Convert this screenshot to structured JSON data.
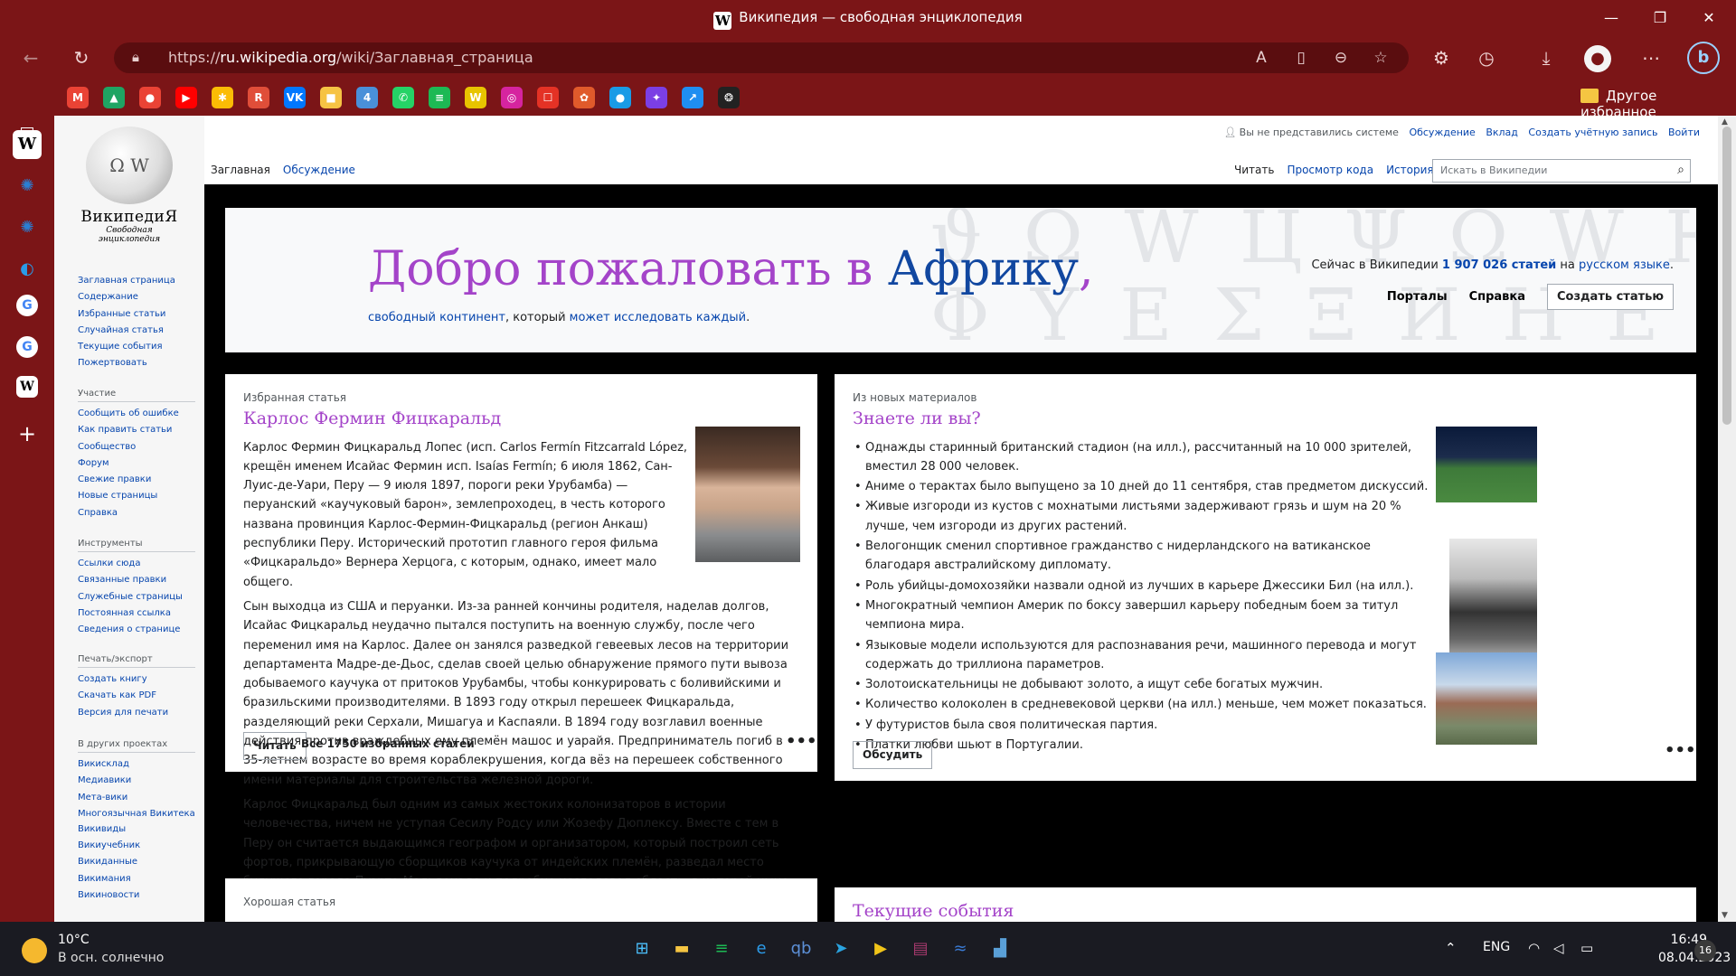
{
  "window": {
    "title": "Википедия — свободная энциклопедия",
    "minimize": "—",
    "maximize": "❐",
    "close": "✕"
  },
  "toolbar": {
    "url_prefix": "https://",
    "url_domain": "ru.wikipedia.org",
    "url_path": "/wiki/Заглавная_страница",
    "icons": [
      "back-icon",
      "refresh-icon",
      "read-aloud-icon",
      "immersive-reader-icon",
      "zoom-icon",
      "favorite-add-icon",
      "extensions-icon",
      "history-icon",
      "downloads-icon",
      "profile-icon",
      "more-icon",
      "bing-icon"
    ]
  },
  "bookmarks": {
    "items": [
      {
        "name": "gmail",
        "label": "M",
        "color": "#ea4335"
      },
      {
        "name": "drive",
        "label": "▲",
        "color": "#1fa463"
      },
      {
        "name": "maps",
        "label": "●",
        "color": "#ea4335"
      },
      {
        "name": "youtube",
        "label": "▶",
        "color": "#ff0000"
      },
      {
        "name": "photos",
        "label": "✱",
        "color": "#fbbc05"
      },
      {
        "name": "app-r",
        "label": "R",
        "color": "#e04e39"
      },
      {
        "name": "vk",
        "label": "VK",
        "color": "#0077ff"
      },
      {
        "name": "notes",
        "label": "■",
        "color": "#f6c344"
      },
      {
        "name": "app-4",
        "label": "4",
        "color": "#4a90d9"
      },
      {
        "name": "whatsapp",
        "label": "✆",
        "color": "#25d366"
      },
      {
        "name": "spotify",
        "label": "≡",
        "color": "#1db954"
      },
      {
        "name": "app-w",
        "label": "W",
        "color": "#e8c400"
      },
      {
        "name": "instagram",
        "label": "◎",
        "color": "#d6249f"
      },
      {
        "name": "aliexpress",
        "label": "☐",
        "color": "#e43225"
      },
      {
        "name": "app-star",
        "label": "✿",
        "color": "#e05a2b"
      },
      {
        "name": "app-dots",
        "label": "●",
        "color": "#1a9be6"
      },
      {
        "name": "app-puzzle",
        "label": "✦",
        "color": "#7b3fe4"
      },
      {
        "name": "app-dart",
        "label": "↗",
        "color": "#1f8ef1"
      },
      {
        "name": "openai",
        "label": "❂",
        "color": "#222222"
      }
    ],
    "folder_label": "Другое избранное"
  },
  "wiki": {
    "logo_name": "ВикипедиЯ",
    "logo_tagline": "Свободная энциклопедия",
    "personal": {
      "not_logged": "Вы не представились системе",
      "talk": "Обсуждение",
      "contrib": "Вклад",
      "create_account": "Создать учётную запись",
      "login": "Войти"
    },
    "tabs": {
      "main": "Заглавная",
      "discussion": "Обсуждение",
      "read": "Читать",
      "view_source": "Просмотр кода",
      "history": "История"
    },
    "search_placeholder": "Искать в Википедии",
    "nav_main": [
      "Заглавная страница",
      "Содержание",
      "Избранные статьи",
      "Случайная статья",
      "Текущие события",
      "Пожертвовать"
    ],
    "nav_participation": {
      "heading": "Участие",
      "items": [
        "Сообщить об ошибке",
        "Как править статьи",
        "Сообщество",
        "Форум",
        "Свежие правки",
        "Новые страницы",
        "Справка"
      ]
    },
    "nav_tools": {
      "heading": "Инструменты",
      "items": [
        "Ссылки сюда",
        "Связанные правки",
        "Служебные страницы",
        "Постоянная ссылка",
        "Сведения о странице"
      ]
    },
    "nav_print": {
      "heading": "Печать/экспорт",
      "items": [
        "Создать книгу",
        "Скачать как PDF",
        "Версия для печати"
      ]
    },
    "nav_projects": {
      "heading": "В других проектах",
      "items": [
        "Викисклад",
        "Медиавики",
        "Мета-вики",
        "Многоязычная Викитека",
        "Викивиды",
        "Викиучебник",
        "Викиданные",
        "Викимания",
        "Викиновости"
      ]
    }
  },
  "banner": {
    "welcome_a": "Добро пожаловать в ",
    "welcome_b": "Африку",
    "welcome_c": ",",
    "sub_link1": "свободный континент",
    "sub_mid": ", который ",
    "sub_link2": "может исследовать каждый",
    "sub_end": ".",
    "count_pre": "Сейчас в Википедии ",
    "count_num": "1 907 026 статей",
    "count_mid": " на ",
    "count_lang": "русском языке",
    "count_end": ".",
    "portals": "Порталы",
    "help": "Справка",
    "create": "Создать статью",
    "bg_glyphs": "ϑ Ω W Ц Ψ Ω W Ю Щ\nΦ Y E Σ Ξ И Н Е Ж"
  },
  "featured": {
    "kicker": "Избранная статья",
    "title": "Карлос Фермин Фицкаральд",
    "p1": "Карлос Фермин Фицкаральд Лопес (исп. Carlos Fermín Fitzcarrald López, крещён именем Исайас Фермин исп. Isaías Fermín; 6 июля 1862, Сан-Луис-де-Уари, Перу — 9 июля 1897, пороги реки Урубамба) — перуанский «каучуковый барон», землепроходец, в честь которого названа провинция Карлос-Фермин-Фицкаральд (регион Анкаш) республики Перу. Исторический прототип главного героя фильма «Фицкаральдо» Вернера Херцога, с которым, однако, имеет мало общего.",
    "p2": "Сын выходца из США и перуанки. Из-за ранней кончины родителя, наделав долгов, Исайас Фицкаральд неудачно пытался поступить на военную службу, после чего переменил имя на Карлос. Далее он занялся разведкой гевеевых лесов на территории департамента Мадре-де-Дьос, сделав своей целью обнаружение прямого пути вывоза добываемого каучука от притоков Урубамбы, чтобы конкурировать с боливийскими и бразильскими производителями. В 1893 году открыл перешеек Фицкаральда, разделяющий реки Серхали, Мишагуа и Каспаяли. В 1894 году возглавил военные действия против враждебных ему племён машос и уарайя. Предприниматель погиб в 35-летнем возрасте во время кораблекрушения, когда вёз на перешеек собственного имени материалы для строительства железной дороги.",
    "p3": "Карлос Фицкаральд был одним из самых жестоких колонизаторов в истории человечества, ничем не уступая Сесилу Родсу или Жозефу Дюплексу. Вместе с тем в Перу он считается выдающимся географом и организатором, который построил сеть фортов, прикрывающую сборщиков каучука от индейских племён, разведал место будущего города Пуэрто-Мальдонадо и подробно исследовал область, в которой ныне расположен заповедник Рио-Ману.",
    "read_btn": "Читать",
    "all_link": "Все 1750 избранных статей",
    "more": "•••"
  },
  "dyk": {
    "kicker": "Из новых материалов",
    "title": "Знаете ли вы?",
    "items": [
      "Однажды старинный британский стадион (на илл.), рассчитанный на 10 000 зрителей, вместил 28 000 человек.",
      "Аниме о терактах было выпущено за 10 дней до 11 сентября, став предметом дискуссий.",
      "Живые изгороди из кустов с мохнатыми листьями задерживают грязь и шум на 20 % лучше, чем изгороди из других растений.",
      "Велогонщик сменил спортивное гражданство с нидерландского на ватиканское благодаря австралийскому дипломату.",
      "Роль убийцы-домохозяйки назвали одной из лучших в карьере Джессики Бил (на илл.).",
      "Многократный чемпион Америк по боксу завершил карьеру победным боем за титул чемпиона мира.",
      "Языковые модели используются для распознавания речи, машинного перевода и могут содержать до триллиона параметров.",
      "Золотоискательницы не добывают золото, а ищут себе богатых мужчин.",
      "Количество колоколен в средневековой церкви (на илл.) меньше, чем может показаться.",
      "У футуристов была своя политическая партия.",
      "Платки любви шьют в Португалии."
    ],
    "discuss_btn": "Обсудить",
    "more": "•••"
  },
  "bottom": {
    "good_kicker": "Хорошая статья",
    "current_title": "Текущие события"
  },
  "taskbar": {
    "temp": "10°C",
    "weather": "В осн. солнечно",
    "lang": "ENG",
    "time": "16:49",
    "date": "08.04.2023",
    "notif_count": "16",
    "apps": [
      {
        "name": "start",
        "label": "⊞",
        "color": "#4cc2ff"
      },
      {
        "name": "explorer",
        "label": "▬",
        "color": "#f5c542"
      },
      {
        "name": "spotify",
        "label": "≡",
        "color": "#1db954"
      },
      {
        "name": "edge",
        "label": "e",
        "color": "#2c9be8"
      },
      {
        "name": "qbittorrent",
        "label": "qb",
        "color": "#5c8fd6"
      },
      {
        "name": "telegram",
        "label": "➤",
        "color": "#2aa3df"
      },
      {
        "name": "player",
        "label": "▶",
        "color": "#f0c419"
      },
      {
        "name": "winrar",
        "label": "▤",
        "color": "#a73a6e"
      },
      {
        "name": "app-wave",
        "label": "≈",
        "color": "#3a7bd5"
      },
      {
        "name": "app-chart",
        "label": "▟",
        "color": "#5aa0d8"
      }
    ]
  }
}
